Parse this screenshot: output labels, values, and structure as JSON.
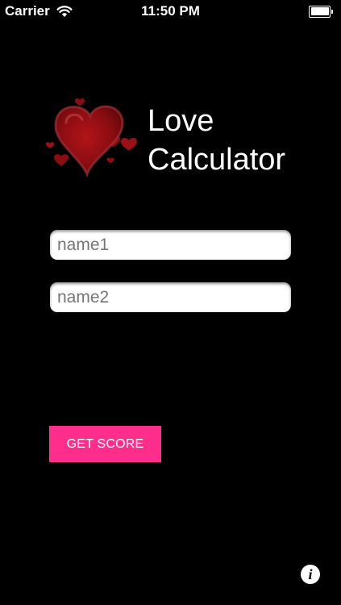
{
  "status_bar": {
    "carrier": "Carrier",
    "time": "11:50 PM",
    "battery_level": 1.0
  },
  "header": {
    "title_line1": "Love",
    "title_line2": "Calculator"
  },
  "form": {
    "name1_placeholder": "name1",
    "name2_placeholder": "name2",
    "name1_value": "",
    "name2_value": ""
  },
  "actions": {
    "get_score_label": "GET SCORE",
    "info_glyph": "i"
  },
  "colors": {
    "background": "#000000",
    "accent": "#ff2d8c",
    "heart": "#8b0d12",
    "text": "#ffffff"
  },
  "icons": {
    "logo": "hearts-logo-icon",
    "info": "info-icon",
    "wifi": "wifi-icon",
    "battery": "battery-icon"
  }
}
